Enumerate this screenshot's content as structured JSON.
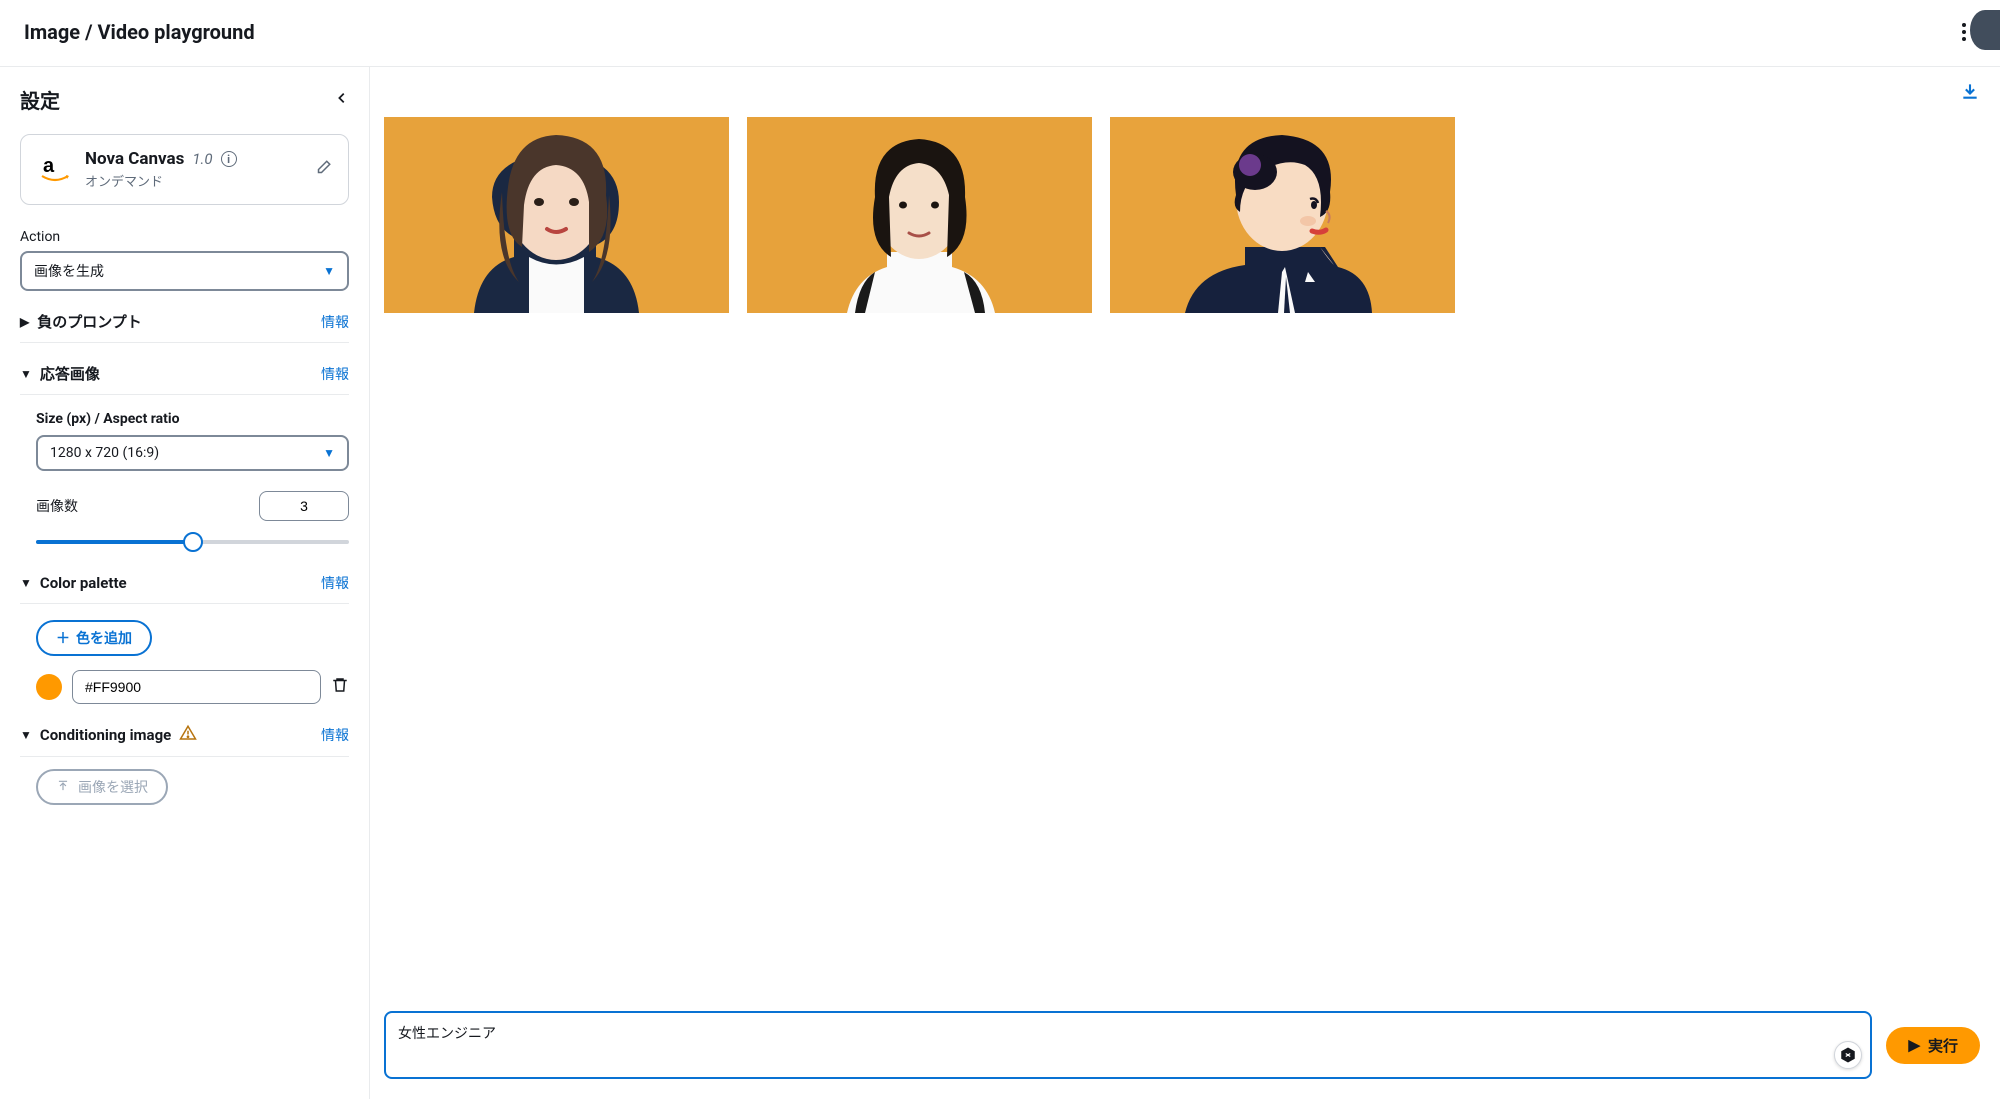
{
  "header": {
    "title": "Image / Video playground"
  },
  "sidebar": {
    "settings_title": "設定",
    "model": {
      "name": "Nova Canvas",
      "version": "1.0",
      "subtitle": "オンデマンド"
    },
    "action": {
      "label": "Action",
      "value": "画像を生成"
    },
    "neg_prompt": {
      "label": "負のプロンプト",
      "info": "情報"
    },
    "response": {
      "label": "応答画像",
      "info": "情報",
      "size_label": "Size (px) / Aspect ratio",
      "size_value": "1280 x 720 (16:9)",
      "count_label": "画像数",
      "count_value": "3",
      "slider_percent": 50
    },
    "palette": {
      "label": "Color palette",
      "info": "情報",
      "add_label": "色を追加",
      "colors": [
        {
          "hex": "#FF9900"
        }
      ]
    },
    "conditioning": {
      "label": "Conditioning image",
      "info": "情報",
      "upload_label": "画像を選択"
    }
  },
  "main": {
    "prompt_value": "女性エンジニア",
    "run_label": "実行"
  }
}
